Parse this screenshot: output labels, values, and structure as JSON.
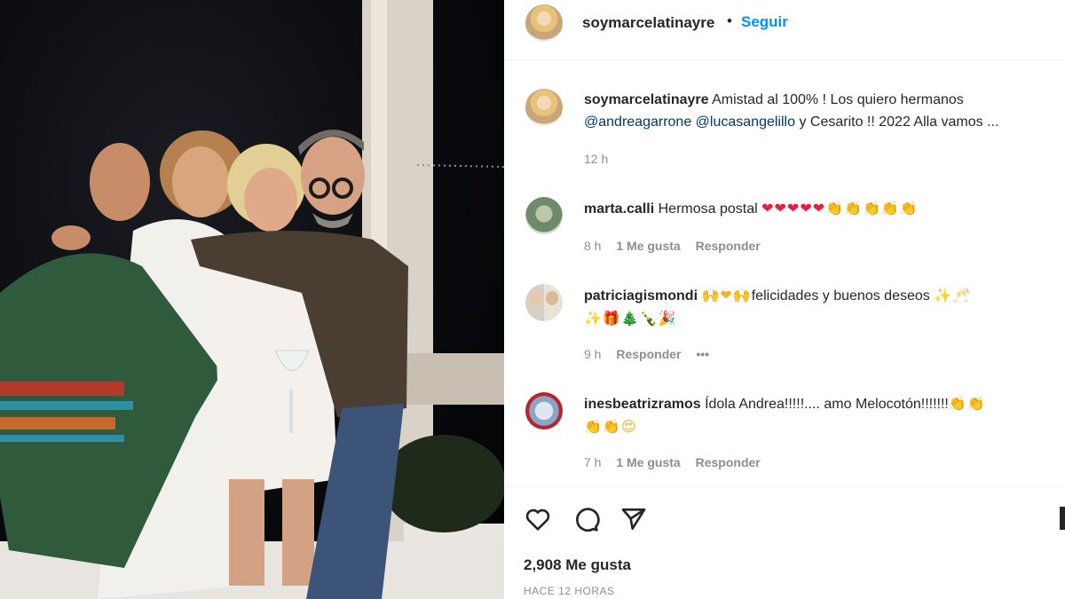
{
  "post": {
    "username": "soymarcelatinayre",
    "separator": "•",
    "follow_label": "Seguir",
    "caption_text": "Amistad al 100% ! Los quiero hermanos",
    "caption_mention_1": "@andreagarrone",
    "caption_mention_2": "@lucasangelillo",
    "caption_tail": "y Cesarito !! 2022 Alla vamos ...",
    "caption_time": "12 h",
    "likes": "2,908 Me gusta",
    "time_ago": "HACE 12 HORAS"
  },
  "comments": [
    {
      "username": "marta.calli",
      "text": "Hermosa postal",
      "emoji": "❤❤❤❤❤👏👏👏👏👏",
      "time": "8 h",
      "likes": "1 Me gusta",
      "reply": "Responder"
    },
    {
      "username": "patriciagismondi",
      "emoji_a": "🙌❤🙌",
      "text": "felicidades y buenos deseos",
      "emoji_b": "✨🥂",
      "emoji_line2": "✨🎁🎄🍾🎉",
      "time": "9 h",
      "reply": "Responder",
      "more": "•••"
    },
    {
      "username": "inesbeatrizramos",
      "text": "Ídola Andrea!!!!!.... amo Melocotón!!!!!!!",
      "emoji_a": "👏👏",
      "emoji_line2": "👏👏😍",
      "time": "7 h",
      "likes": "1 Me gusta",
      "reply": "Responder"
    }
  ],
  "icons": {
    "like": "heart-outline-icon",
    "comment": "comment-bubble-icon",
    "share": "paper-plane-icon",
    "save": "bookmark-icon"
  },
  "colors": {
    "link_blue": "#0095f6",
    "mention": "#00376b",
    "muted": "#8e8e8e",
    "text": "#262626"
  }
}
